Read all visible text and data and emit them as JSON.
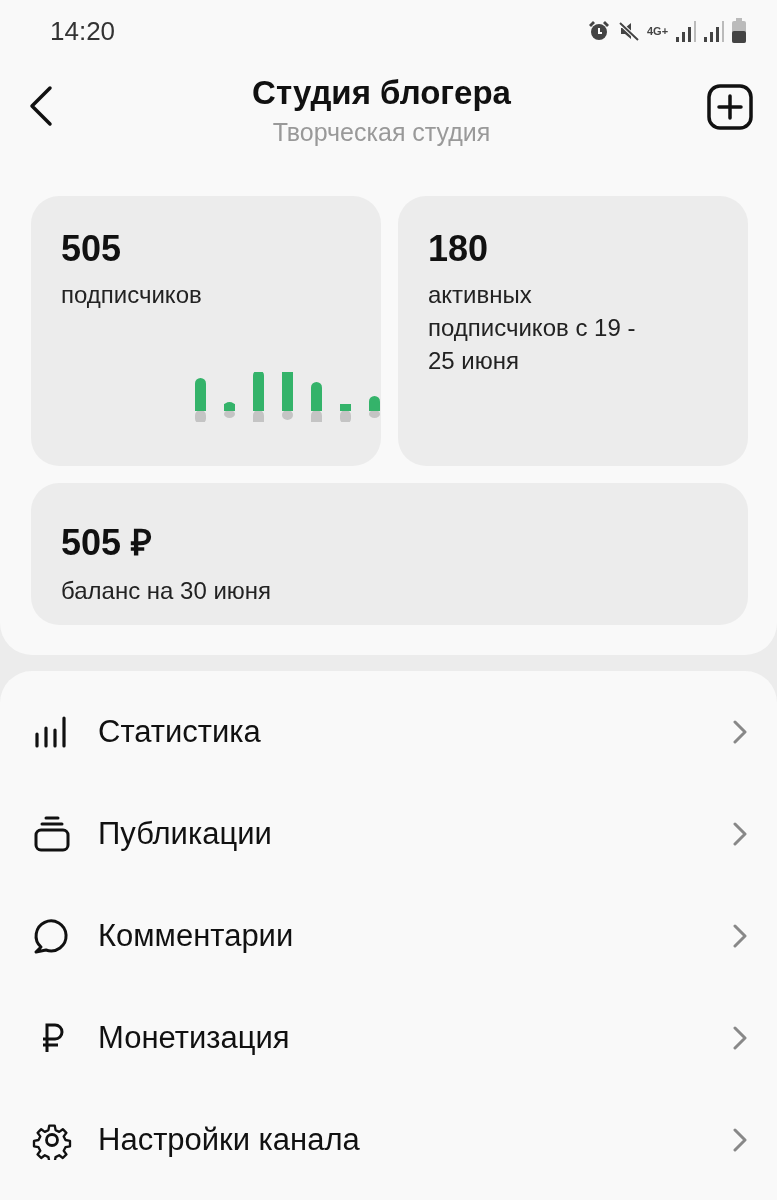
{
  "status_bar": {
    "time": "14:20",
    "network": "4G+"
  },
  "header": {
    "title": "Студия блогера",
    "subtitle": "Творческая студия"
  },
  "stats": [
    {
      "value": "505",
      "label": "подписчиков",
      "kind": "sparkline"
    },
    {
      "value": "180",
      "label": "активных подписчиков с 19 - 25 июня",
      "kind": "plain"
    }
  ],
  "balance": {
    "value": "505 ₽",
    "label": "баланс на 30 июня"
  },
  "menu": [
    {
      "label": "Статистика"
    },
    {
      "label": "Публикации"
    },
    {
      "label": "Комментарии"
    },
    {
      "label": "Монетизация"
    },
    {
      "label": "Настройки канала"
    }
  ]
}
